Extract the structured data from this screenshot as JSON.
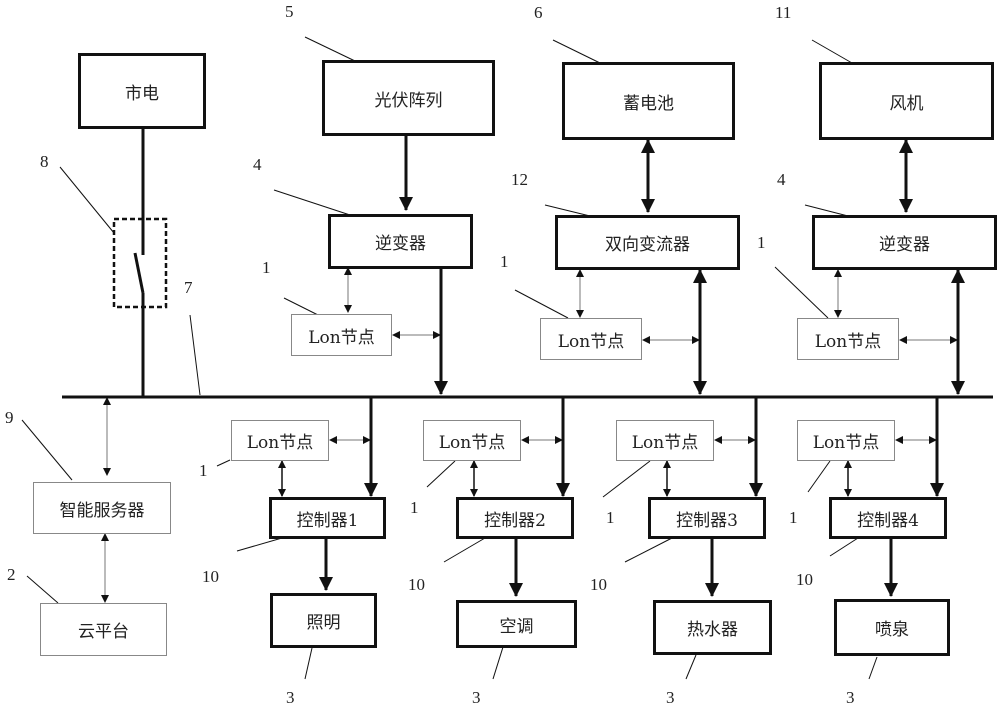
{
  "blocks": {
    "grid": "市电",
    "pv_array": "光伏阵列",
    "battery": "蓄电池",
    "wind_turbine": "风机",
    "inverter_pv": "逆变器",
    "bidirectional_converter": "双向变流器",
    "inverter_wind": "逆变器",
    "smart_server": "智能服务器",
    "cloud_platform": "云平台",
    "lon_nodes": [
      "Lon节点",
      "Lon节点",
      "Lon节点",
      "Lon节点",
      "Lon节点",
      "Lon节点",
      "Lon节点"
    ],
    "controllers": [
      "控制器1",
      "控制器2",
      "控制器3",
      "控制器4"
    ],
    "loads": [
      "照明",
      "空调",
      "热水器",
      "喷泉"
    ]
  },
  "reference_numbers": {
    "pv_array": "5",
    "battery": "6",
    "wind_turbine": "11",
    "inverter_pv": "4",
    "converter": "12",
    "inverter_wind": "4",
    "switch": "8",
    "bus": "7",
    "smart_server": "9",
    "cloud_platform": "2",
    "lon_top": [
      "1",
      "1",
      "1"
    ],
    "lon_bottom": [
      "1",
      "1",
      "1",
      "1"
    ],
    "controllers": [
      "10",
      "10",
      "10",
      "10"
    ],
    "loads": [
      "3",
      "3",
      "3",
      "3"
    ]
  }
}
